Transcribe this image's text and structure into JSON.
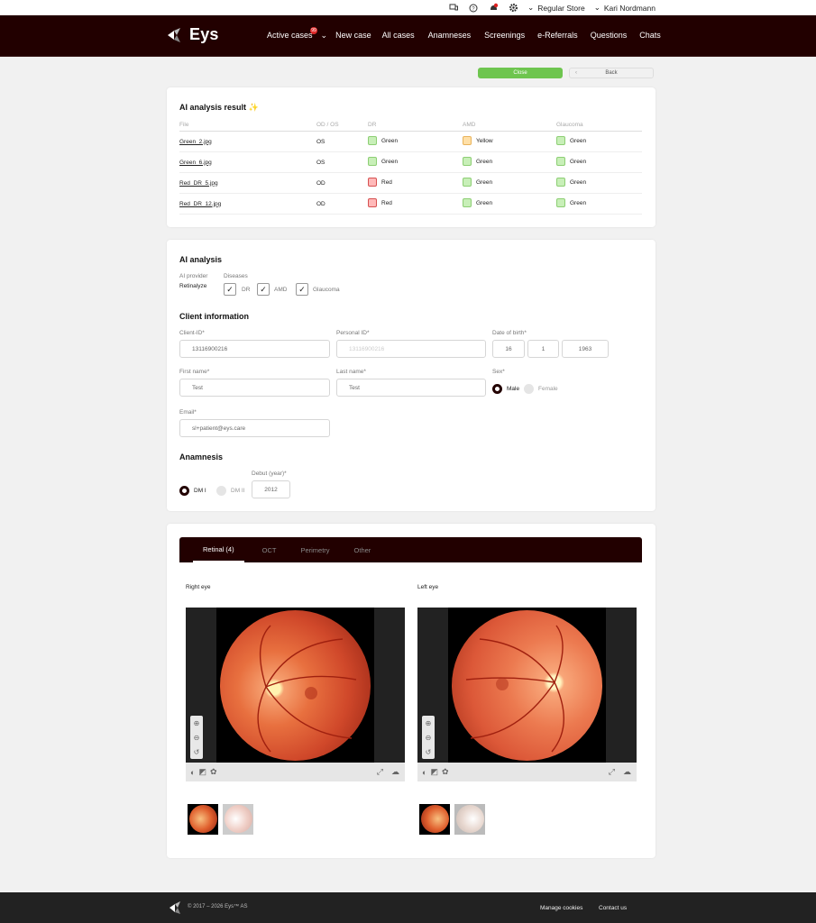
{
  "util": {
    "store": "Regular Store",
    "user": "Kari Nordmann"
  },
  "nav": {
    "brand": "Eys",
    "items": [
      "Active cases",
      "New case",
      "All cases",
      "Anamneses",
      "Screenings",
      "e-Referrals",
      "Questions",
      "Chats"
    ],
    "badge": "99"
  },
  "actions": {
    "close": "Close",
    "back": "Back"
  },
  "ai_result": {
    "title": "AI analysis result ✨",
    "headers": [
      "File",
      "OD / OS",
      "DR",
      "AMD",
      "Glaucoma"
    ],
    "rows": [
      {
        "file": "Green_2.jpg",
        "eye": "OS",
        "dr": "Green",
        "dr_c": "green",
        "amd": "Yellow",
        "amd_c": "yellow",
        "gl": "Green",
        "gl_c": "green"
      },
      {
        "file": "Green_6.jpg",
        "eye": "OS",
        "dr": "Green",
        "dr_c": "green",
        "amd": "Green",
        "amd_c": "green",
        "gl": "Green",
        "gl_c": "green"
      },
      {
        "file": "Red_DR_5.jpg",
        "eye": "OD",
        "dr": "Red",
        "dr_c": "red",
        "amd": "Green",
        "amd_c": "green",
        "gl": "Green",
        "gl_c": "green"
      },
      {
        "file": "Red_DR_12.jpg",
        "eye": "OD",
        "dr": "Red",
        "dr_c": "red",
        "amd": "Green",
        "amd_c": "green",
        "gl": "Green",
        "gl_c": "green"
      }
    ]
  },
  "ai": {
    "title": "AI analysis",
    "provider_label": "AI provider",
    "provider": "Retinalyze",
    "diseases_label": "Diseases",
    "diseases": [
      "DR",
      "AMD",
      "Glaucoma"
    ]
  },
  "client": {
    "title": "Client information",
    "client_id_label": "Client-ID*",
    "client_id": "13116900216",
    "personal_id_label": "Personal ID*",
    "personal_id_ph": "13116900216",
    "dob_label": "Date of birth*",
    "dob_day": "16",
    "dob_month": "1",
    "dob_year": "1963",
    "first_label": "First name*",
    "first": "Test",
    "last_label": "Last name*",
    "last": "Test",
    "sex_label": "Sex*",
    "male": "Male",
    "female": "Female",
    "email_label": "Email*",
    "email": "sl+patient@eys.care"
  },
  "anamnesis": {
    "title": "Anamnesis",
    "dm1": "DM I",
    "dm2": "DM II",
    "debut_label": "Debut (year)*",
    "debut": "2012"
  },
  "images": {
    "tabs": [
      "Retinal (4)",
      "OCT",
      "Perimetry",
      "Other"
    ],
    "right": "Right eye",
    "left": "Left eye"
  },
  "footer": {
    "copy": "© 2017 – 2026 Eys™ AS",
    "cookies": "Manage cookies",
    "contact": "Contact us"
  },
  "colors": {
    "nav": "#220000",
    "green": "#6ec54f"
  }
}
